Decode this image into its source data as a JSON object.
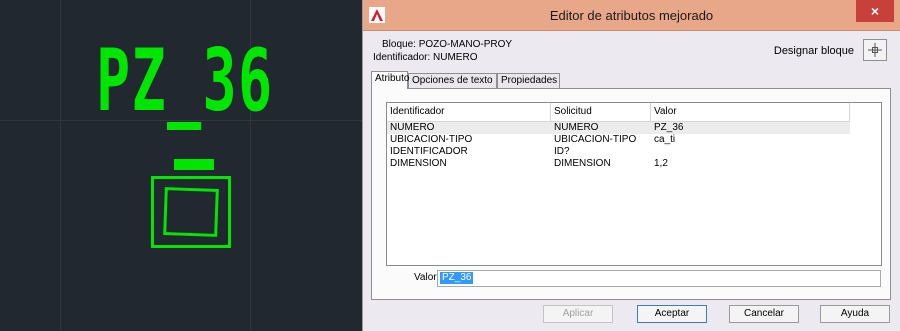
{
  "cad": {
    "label": "PZ_36",
    "color": "#00e600",
    "background": "#212830"
  },
  "dialog": {
    "title": "Editor de atributos mejorado",
    "close_label": "×",
    "bloque_line": "Bloque: POZO-MANO-PROY",
    "identificador_line": "Identificador: NUMERO",
    "designar_label": "Designar bloque",
    "tabs": [
      {
        "label": "Atributo"
      },
      {
        "label": "Opciones de texto"
      },
      {
        "label": "Propiedades"
      }
    ],
    "table": {
      "headers": [
        "Identificador",
        "Solicitud",
        "Valor"
      ],
      "rows": [
        {
          "identificador": "NUMERO",
          "solicitud": "NUMERO",
          "valor": "PZ_36"
        },
        {
          "identificador": "UBICACION-TIPO",
          "solicitud": "UBICACION-TIPO",
          "valor": "ca_ti"
        },
        {
          "identificador": "IDENTIFICADOR",
          "solicitud": "ID?",
          "valor": ""
        },
        {
          "identificador": "DIMENSION",
          "solicitud": "DIMENSION",
          "valor": "1,2"
        }
      ]
    },
    "valor_label": "Valor:",
    "valor_value": "PZ_36",
    "buttons": {
      "aplicar": "Aplicar",
      "aceptar": "Aceptar",
      "cancelar": "Cancelar",
      "ayuda": "Ayuda"
    },
    "colors": {
      "titlebar": "#e9a78a",
      "close": "#c7413a",
      "selection": "#3399ff"
    }
  }
}
